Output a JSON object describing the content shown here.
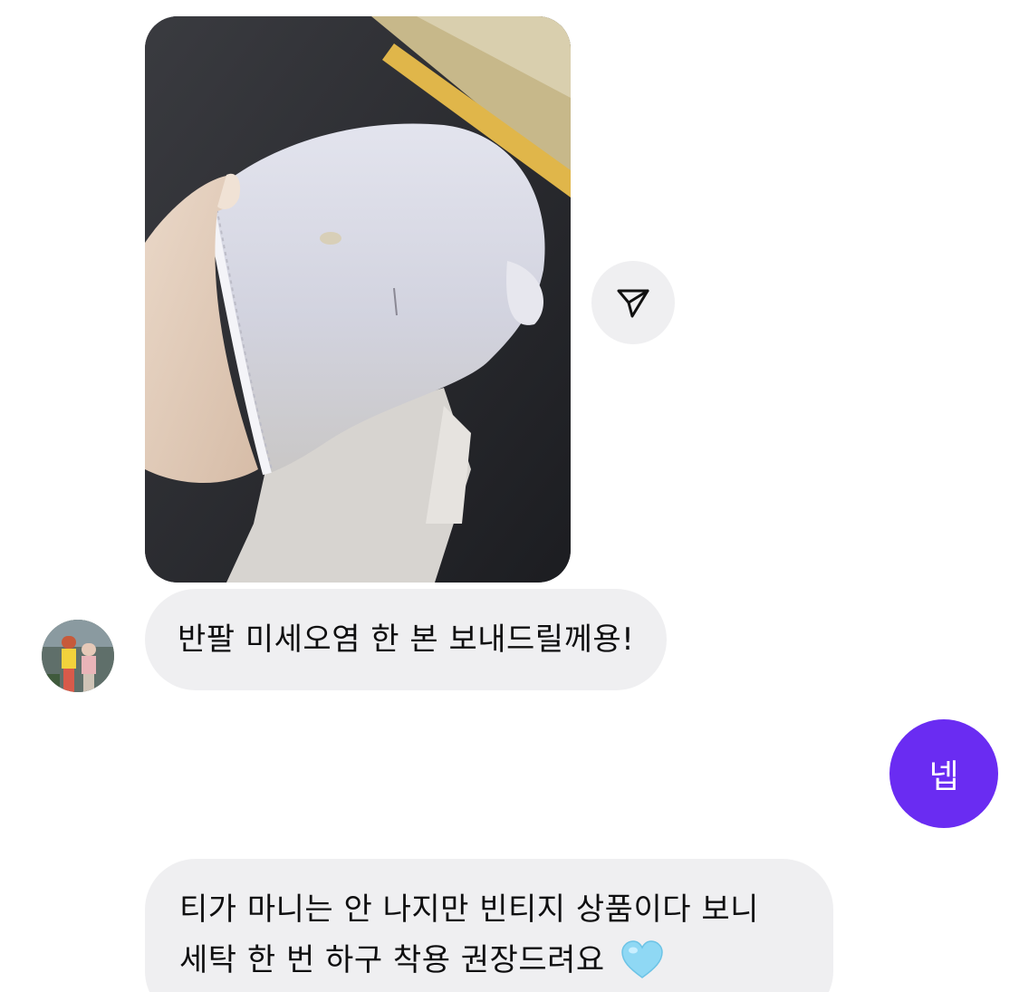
{
  "messages": {
    "incoming_1": "반팔 미세오염 한 본 보내드릴께용!",
    "outgoing_1": "넵",
    "incoming_2_line1": "티가 마니는 안 나지만 빈티지 상품이다 보니",
    "incoming_2_line2": "세탁 한 번 하구 착용 권장드려요"
  },
  "icons": {
    "share": "paper-plane-icon",
    "emoji": "light-blue-heart"
  },
  "colors": {
    "incoming_bubble": "#efeff1",
    "outgoing_bubble": "#6a2cf2",
    "heart": "#8fd8f4"
  }
}
